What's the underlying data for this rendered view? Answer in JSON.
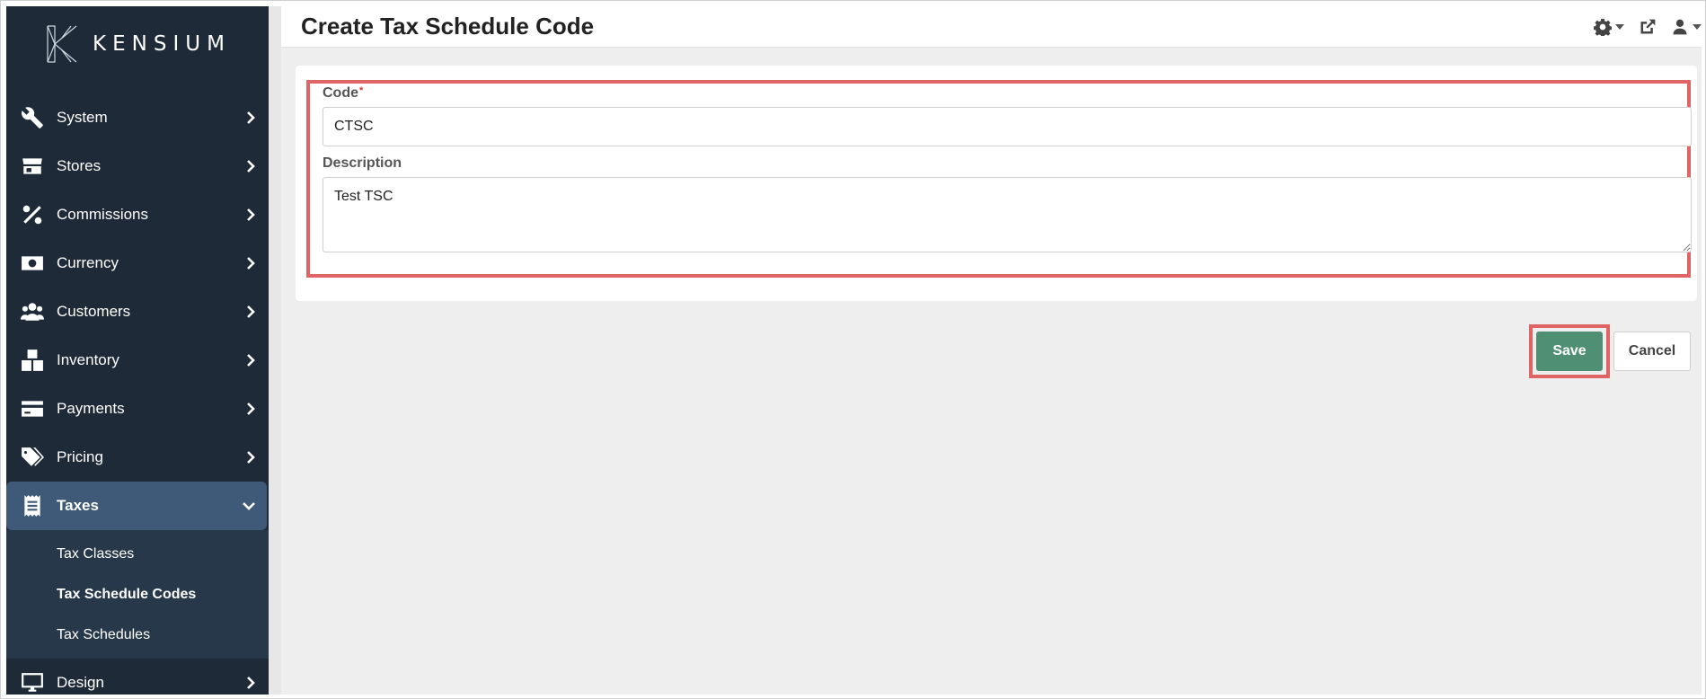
{
  "app": {
    "logo_text": "KENSIUM"
  },
  "header": {
    "title": "Create Tax Schedule Code"
  },
  "sidebar": {
    "items": [
      {
        "label": "System",
        "icon": "wrench-icon"
      },
      {
        "label": "Stores",
        "icon": "store-icon"
      },
      {
        "label": "Commissions",
        "icon": "percent-icon"
      },
      {
        "label": "Currency",
        "icon": "money-icon"
      },
      {
        "label": "Customers",
        "icon": "users-icon"
      },
      {
        "label": "Inventory",
        "icon": "boxes-icon"
      },
      {
        "label": "Payments",
        "icon": "credit-card-icon"
      },
      {
        "label": "Pricing",
        "icon": "tags-icon"
      },
      {
        "label": "Taxes",
        "icon": "receipt-icon"
      },
      {
        "label": "Design",
        "icon": "monitor-icon"
      }
    ],
    "taxes_subitems": [
      {
        "label": "Tax Classes"
      },
      {
        "label": "Tax Schedule Codes"
      },
      {
        "label": "Tax Schedules"
      }
    ]
  },
  "form": {
    "code_label": "Code",
    "code_required_mark": "*",
    "code_value": "CTSC",
    "description_label": "Description",
    "description_value": "Test TSC"
  },
  "actions": {
    "save_label": "Save",
    "cancel_label": "Cancel"
  },
  "colors": {
    "sidebar_bg": "#1e2a37",
    "active_item": "#3e5a78",
    "save_button": "#4f8f73",
    "highlight": "#e06464"
  }
}
